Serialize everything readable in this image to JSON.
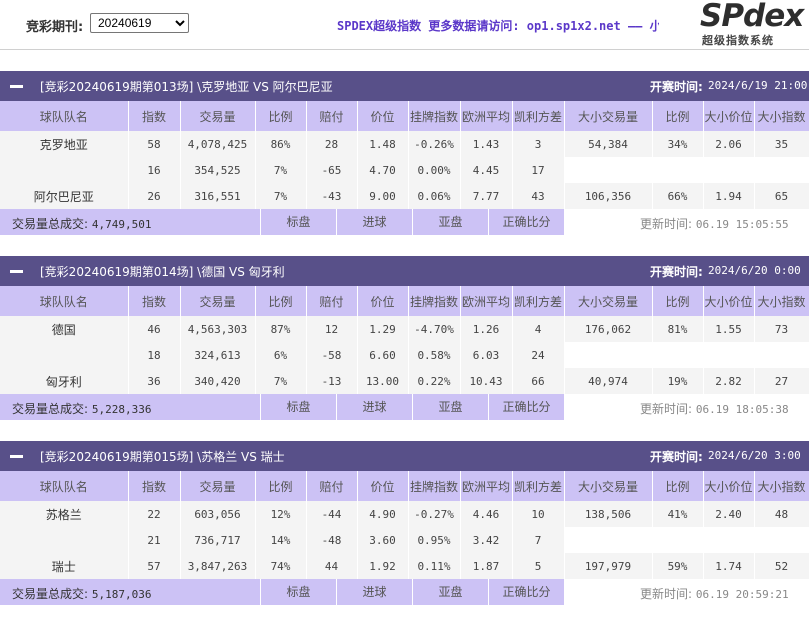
{
  "header": {
    "period_label": "竞彩期刊:",
    "period_value": "20240619",
    "marquee": "SPDEX超级指数 更多数据请访问: op1.sp1x2.net —— 小",
    "logo_main": "SPdex",
    "logo_sub": "超级指数系统"
  },
  "columns": [
    "球队队名",
    "指数",
    "交易量",
    "比例",
    "赔付",
    "价位",
    "挂牌指数",
    "欧洲平均",
    "凯利方差",
    "大小交易量",
    "比例",
    "大小价位",
    "大小指数"
  ],
  "kickoff_label": "开赛时间:",
  "total_label": "交易量总成交:",
  "tabs": [
    "标盘",
    "进球",
    "亚盘",
    "正确比分"
  ],
  "updated_label": "更新时间:",
  "matches": [
    {
      "title": "[竞彩20240619期第013场] \\克罗地亚 VS 阿尔巴尼亚",
      "kickoff": "2024/6/19 21:00",
      "rows": [
        [
          "克罗地亚",
          "58",
          "4,078,425",
          "86%",
          "28",
          "1.48",
          "-0.26%",
          "1.43",
          "3",
          "54,384",
          "34%",
          "2.06",
          "35"
        ],
        [
          "",
          "16",
          "354,525",
          "7%",
          "-65",
          "4.70",
          "0.00%",
          "4.45",
          "17",
          "",
          "",
          "",
          ""
        ],
        [
          "阿尔巴尼亚",
          "26",
          "316,551",
          "7%",
          "-43",
          "9.00",
          "0.06%",
          "7.77",
          "43",
          "106,356",
          "66%",
          "1.94",
          "65"
        ]
      ],
      "total": "4,749,501",
      "updated": "06.19 15:05:55"
    },
    {
      "title": "[竞彩20240619期第014场] \\德国 VS 匈牙利",
      "kickoff": "2024/6/20 0:00",
      "rows": [
        [
          "德国",
          "46",
          "4,563,303",
          "87%",
          "12",
          "1.29",
          "-4.70%",
          "1.26",
          "4",
          "176,062",
          "81%",
          "1.55",
          "73"
        ],
        [
          "",
          "18",
          "324,613",
          "6%",
          "-58",
          "6.60",
          "0.58%",
          "6.03",
          "24",
          "",
          "",
          "",
          ""
        ],
        [
          "匈牙利",
          "36",
          "340,420",
          "7%",
          "-13",
          "13.00",
          "0.22%",
          "10.43",
          "66",
          "40,974",
          "19%",
          "2.82",
          "27"
        ]
      ],
      "total": "5,228,336",
      "updated": "06.19 18:05:38"
    },
    {
      "title": "[竞彩20240619期第015场] \\苏格兰 VS 瑞士",
      "kickoff": "2024/6/20 3:00",
      "rows": [
        [
          "苏格兰",
          "22",
          "603,056",
          "12%",
          "-44",
          "4.90",
          "-0.27%",
          "4.46",
          "10",
          "138,506",
          "41%",
          "2.40",
          "48"
        ],
        [
          "",
          "21",
          "736,717",
          "14%",
          "-48",
          "3.60",
          "0.95%",
          "3.42",
          "7",
          "",
          "",
          "",
          ""
        ],
        [
          "瑞士",
          "57",
          "3,847,263",
          "74%",
          "44",
          "1.92",
          "0.11%",
          "1.87",
          "5",
          "197,979",
          "59%",
          "1.74",
          "52"
        ]
      ],
      "total": "5,187,036",
      "updated": "06.19 20:59:21"
    }
  ]
}
